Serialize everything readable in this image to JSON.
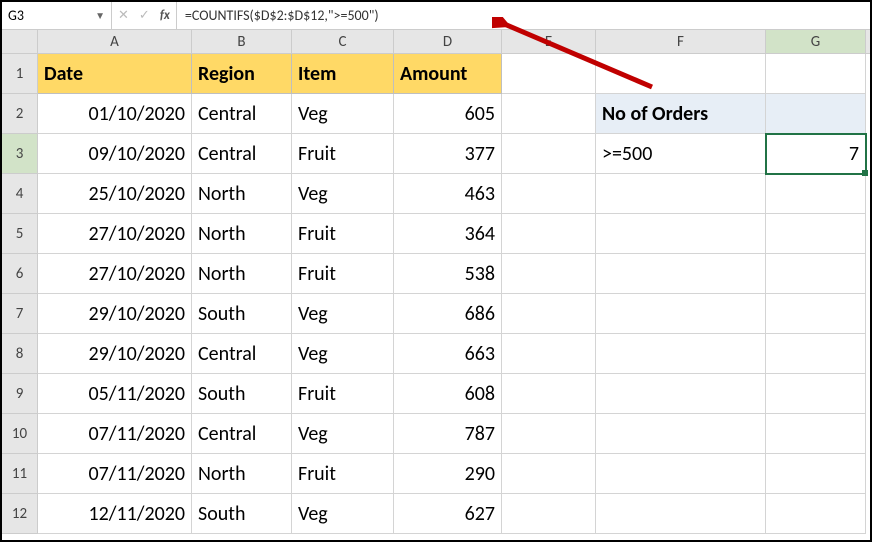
{
  "namebox": "G3",
  "formula": "=COUNTIFS($D$2:$D$12,\">=500\")",
  "columns": [
    "A",
    "B",
    "C",
    "D",
    "E",
    "F",
    "G"
  ],
  "col_widths": [
    "colA",
    "colB",
    "colC",
    "colD",
    "colE",
    "colF",
    "colG"
  ],
  "headers": {
    "A": "Date",
    "B": "Region",
    "C": "Item",
    "D": "Amount"
  },
  "label": "No of Orders",
  "criteria": ">=500",
  "result": "7",
  "data_rows": [
    {
      "n": "2",
      "date": "01/10/2020",
      "region": "Central",
      "item": "Veg",
      "amount": "605"
    },
    {
      "n": "3",
      "date": "09/10/2020",
      "region": "Central",
      "item": "Fruit",
      "amount": "377"
    },
    {
      "n": "4",
      "date": "25/10/2020",
      "region": "North",
      "item": "Veg",
      "amount": "463"
    },
    {
      "n": "5",
      "date": "27/10/2020",
      "region": "North",
      "item": "Fruit",
      "amount": "364"
    },
    {
      "n": "6",
      "date": "27/10/2020",
      "region": "North",
      "item": "Fruit",
      "amount": "538"
    },
    {
      "n": "7",
      "date": "29/10/2020",
      "region": "South",
      "item": "Veg",
      "amount": "686"
    },
    {
      "n": "8",
      "date": "29/10/2020",
      "region": "Central",
      "item": "Veg",
      "amount": "663"
    },
    {
      "n": "9",
      "date": "05/11/2020",
      "region": "South",
      "item": "Fruit",
      "amount": "608"
    },
    {
      "n": "10",
      "date": "07/11/2020",
      "region": "Central",
      "item": "Veg",
      "amount": "787"
    },
    {
      "n": "11",
      "date": "07/11/2020",
      "region": "North",
      "item": "Fruit",
      "amount": "290"
    },
    {
      "n": "12",
      "date": "12/11/2020",
      "region": "South",
      "item": "Veg",
      "amount": "627"
    }
  ],
  "chart_data": {
    "type": "table",
    "columns": [
      "Date",
      "Region",
      "Item",
      "Amount"
    ],
    "rows": [
      [
        "01/10/2020",
        "Central",
        "Veg",
        605
      ],
      [
        "09/10/2020",
        "Central",
        "Fruit",
        377
      ],
      [
        "25/10/2020",
        "North",
        "Veg",
        463
      ],
      [
        "27/10/2020",
        "North",
        "Fruit",
        364
      ],
      [
        "27/10/2020",
        "North",
        "Fruit",
        538
      ],
      [
        "29/10/2020",
        "South",
        "Veg",
        686
      ],
      [
        "29/10/2020",
        "Central",
        "Veg",
        663
      ],
      [
        "05/11/2020",
        "South",
        "Fruit",
        608
      ],
      [
        "07/11/2020",
        "Central",
        "Veg",
        787
      ],
      [
        "07/11/2020",
        "North",
        "Fruit",
        290
      ],
      [
        "12/11/2020",
        "South",
        "Veg",
        627
      ]
    ],
    "summary": {
      "label": "No of Orders",
      "criteria": ">=500",
      "result": 7
    }
  }
}
